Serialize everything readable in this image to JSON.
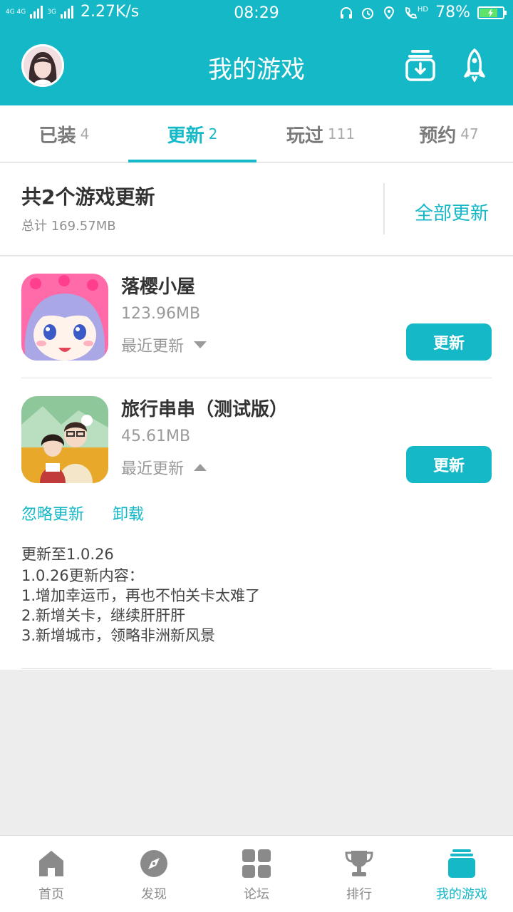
{
  "status_bar": {
    "network_left": "4G 4G",
    "network_mid": "3G",
    "speed": "2.27K/s",
    "time": "08:29",
    "hd": "HD",
    "battery": "78%",
    "battery_level": 0.78
  },
  "header": {
    "title": "我的游戏"
  },
  "tabs": [
    {
      "label": "已装",
      "count": "4"
    },
    {
      "label": "更新",
      "count": "2",
      "active": true
    },
    {
      "label": "玩过",
      "count": "111"
    },
    {
      "label": "预约",
      "count": "47"
    }
  ],
  "summary": {
    "title": "共2个游戏更新",
    "total": "总计  169.57MB",
    "update_all": "全部更新"
  },
  "games": [
    {
      "name": "落樱小屋",
      "size": "123.96MB",
      "recent": "最近更新",
      "button": "更新",
      "expanded": false
    },
    {
      "name": "旅行串串（测试版）",
      "size": "45.61MB",
      "recent": "最近更新",
      "button": "更新",
      "expanded": true
    }
  ],
  "expanded_actions": {
    "ignore": "忽略更新",
    "uninstall": "卸载"
  },
  "update_notes": {
    "version": "更新至1.0.26",
    "lines": [
      "1.0.26更新内容：",
      "1.增加幸运币，再也不怕关卡太难了",
      "2.新增关卡，继续肝肝肝",
      "3.新增城市，领略非洲新风景"
    ]
  },
  "bottom_nav": [
    {
      "label": "首页",
      "icon": "home-icon"
    },
    {
      "label": "发现",
      "icon": "compass-icon"
    },
    {
      "label": "论坛",
      "icon": "grid-icon"
    },
    {
      "label": "排行",
      "icon": "trophy-icon"
    },
    {
      "label": "我的游戏",
      "icon": "my-games-icon",
      "active": true
    }
  ],
  "colors": {
    "accent": "#14b8c6",
    "background": "#ededed"
  }
}
